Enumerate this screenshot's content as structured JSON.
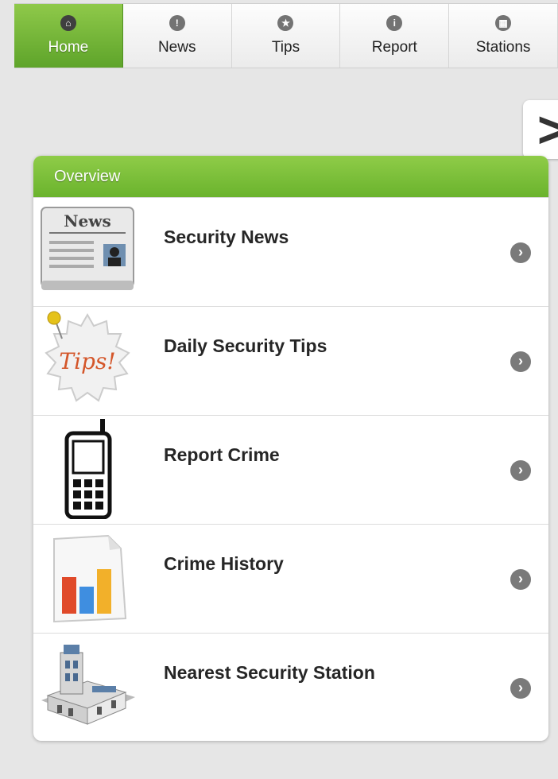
{
  "nav": {
    "tabs": [
      {
        "label": "Home",
        "icon": "home-icon",
        "active": true
      },
      {
        "label": "News",
        "icon": "alert-icon",
        "active": false
      },
      {
        "label": "Tips",
        "icon": "star-icon",
        "active": false
      },
      {
        "label": "Report",
        "icon": "info-icon",
        "active": false
      },
      {
        "label": "Stations",
        "icon": "grid-icon",
        "active": false
      }
    ]
  },
  "pager": {
    "next_symbol": ">"
  },
  "overview": {
    "header": "Overview",
    "items": [
      {
        "label": "Security News",
        "icon": "newspaper-icon",
        "thumb_text": "News"
      },
      {
        "label": "Daily Security Tips",
        "icon": "tips-badge-icon",
        "thumb_text": "Tips!"
      },
      {
        "label": "Report Crime",
        "icon": "mobile-phone-icon"
      },
      {
        "label": "Crime History",
        "icon": "bar-chart-icon"
      },
      {
        "label": "Nearest Security Station",
        "icon": "police-station-icon"
      }
    ],
    "chevron": "›"
  },
  "colors": {
    "accent_green": "#6ab32d",
    "background": "#e6e6e6"
  }
}
